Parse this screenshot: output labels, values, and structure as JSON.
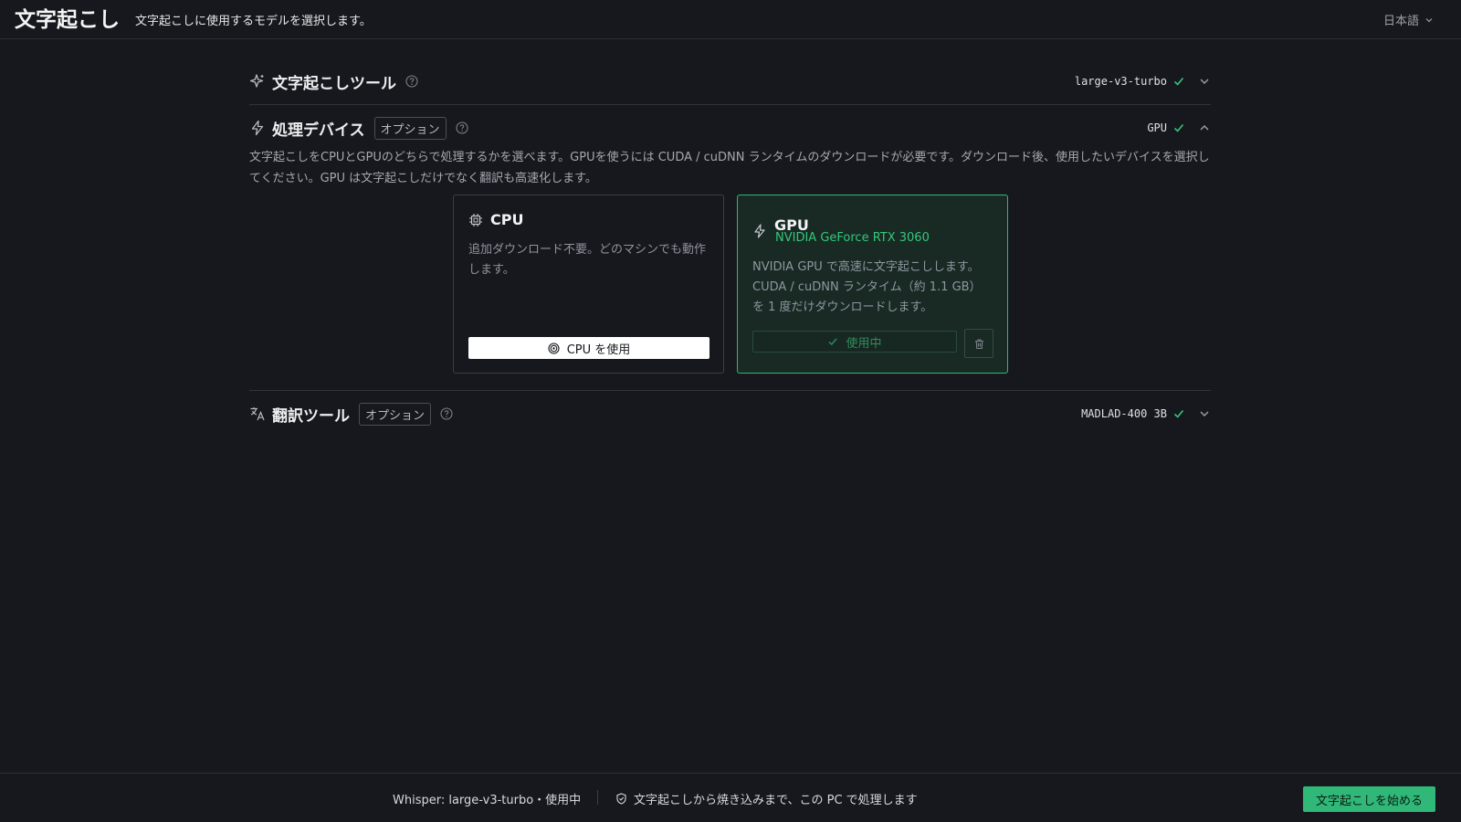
{
  "header": {
    "title": "文字起こし",
    "subtitle": "文字起こしに使用するモデルを選択します。",
    "language": "日本語"
  },
  "sections": {
    "transcription_tool": {
      "label": "文字起こしツール",
      "value": "large-v3-turbo",
      "icon": "sparkle-icon"
    },
    "device": {
      "label": "処理デバイス",
      "tag": "オプション",
      "value": "GPU",
      "icon": "lightning-icon",
      "description": "文字起こしをCPUとGPUのどちらで処理するかを選べます。GPUを使うには CUDA / cuDNN ランタイムのダウンロードが必要です。ダウンロード後、使用したいデバイスを選択してください。GPU は文字起こしだけでなく翻訳も高速化します。",
      "cards": {
        "cpu": {
          "name": "CPU",
          "description": "追加ダウンロード不要。どのマシンでも動作します。",
          "button": "CPU を使用"
        },
        "gpu": {
          "name": "GPU",
          "gpu_model": "NVIDIA GeForce RTX 3060",
          "description": "NVIDIA GPU で高速に文字起こしします。CUDA / cuDNN ランタイム（約 1.1 GB）を 1 度だけダウンロードします。",
          "button": "使用中"
        }
      }
    },
    "translation_tool": {
      "label": "翻訳ツール",
      "tag": "オプション",
      "value": "MADLAD-400 3B",
      "icon": "translate-icon"
    }
  },
  "footer": {
    "status": "Whisper: large-v3-turbo・使用中",
    "local_note": "文字起こしから焼き込みまで、この PC で処理します",
    "start_button": "文字起こしを始める"
  },
  "colors": {
    "background": "#16181d",
    "accent": "#2fb877",
    "accent_text": "#34c77b"
  }
}
